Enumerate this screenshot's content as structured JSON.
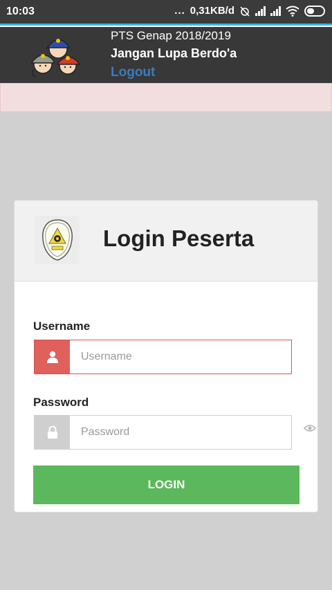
{
  "status_bar": {
    "time": "10:03",
    "dots": "...",
    "network_speed": "0,31KB/d"
  },
  "header": {
    "subtitle": "PTS Genap 2018/2019",
    "title": "Jangan Lupa Berdo'a",
    "logout_label": "Logout"
  },
  "login_card": {
    "title": "Login Peserta",
    "username": {
      "label": "Username",
      "placeholder": "Username",
      "value": ""
    },
    "password": {
      "label": "Password",
      "placeholder": "Password",
      "value": ""
    },
    "submit_label": "LOGIN"
  },
  "colors": {
    "header_bg": "#383838",
    "accent": "#34b6e4",
    "error_addon": "#e0605c",
    "login_button": "#5cb85c",
    "logout_link": "#3a7bc1"
  }
}
